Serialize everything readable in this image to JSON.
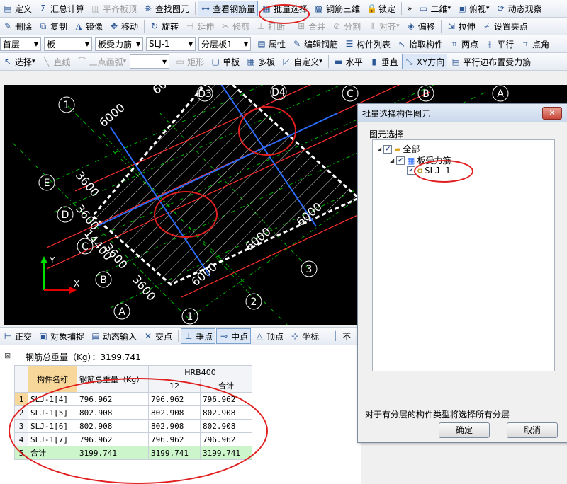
{
  "toolbar1": [
    {
      "label": "定义",
      "icon": "define-icon",
      "glyph": "▤"
    },
    {
      "label": "汇总计算",
      "icon": "sum-icon",
      "glyph": "Σ"
    },
    {
      "label": "平齐板顶",
      "icon": "align-slab-icon",
      "glyph": "▥",
      "disabled": true
    },
    {
      "label": "查找图元",
      "icon": "binoculars-icon",
      "glyph": "⛯"
    },
    {
      "label": "查看钢筋量",
      "icon": "view-rebar-icon",
      "glyph": "⊶",
      "pressed": true
    },
    {
      "label": "批量选择",
      "icon": "batch-select-icon",
      "glyph": "▦"
    },
    {
      "label": "钢筋三维",
      "icon": "rebar-3d-icon",
      "glyph": "▩"
    },
    {
      "label": "锁定",
      "icon": "lock-icon",
      "glyph": "🔒"
    },
    {
      "label": "»",
      "icon": "overflow-icon",
      "glyph": ""
    },
    {
      "label": "二维",
      "icon": "2d-icon",
      "glyph": "▭",
      "combo": true
    },
    {
      "label": "俯视",
      "icon": "top-view-icon",
      "glyph": "▣",
      "combo": true
    },
    {
      "label": "动态观察",
      "icon": "orbit-icon",
      "glyph": "⟳"
    }
  ],
  "toolbar2": [
    {
      "label": "删除",
      "icon": "delete-icon",
      "glyph": "✎"
    },
    {
      "label": "复制",
      "icon": "copy-icon",
      "glyph": "⧉"
    },
    {
      "label": "镜像",
      "icon": "mirror-icon",
      "glyph": "◮"
    },
    {
      "label": "移动",
      "icon": "move-icon",
      "glyph": "✥"
    },
    {
      "label": "旋转",
      "icon": "rotate-icon",
      "glyph": "↻"
    },
    {
      "label": "延伸",
      "icon": "extend-icon",
      "glyph": "⊣",
      "disabled": true
    },
    {
      "label": "修剪",
      "icon": "trim-icon",
      "glyph": "✂",
      "disabled": true
    },
    {
      "label": "打断",
      "icon": "break-icon",
      "glyph": "⊥",
      "disabled": true
    },
    {
      "label": "合并",
      "icon": "merge-icon",
      "glyph": "⊞",
      "disabled": true
    },
    {
      "label": "分割",
      "icon": "split-icon",
      "glyph": "⊘",
      "disabled": true
    },
    {
      "label": "对齐",
      "icon": "align-icon",
      "glyph": "⫴",
      "disabled": true,
      "combo": true
    },
    {
      "label": "偏移",
      "icon": "offset-icon",
      "glyph": "◈"
    },
    {
      "label": "拉伸",
      "icon": "stretch-icon",
      "glyph": "⇲"
    },
    {
      "label": "设置夹点",
      "icon": "grip-icon",
      "glyph": "⌿"
    }
  ],
  "toolbar3": {
    "floor": "首层",
    "category": "板",
    "type": "板受力筋",
    "element": "SLJ-1",
    "layer": "分层板1",
    "buttons": [
      {
        "label": "属性",
        "icon": "properties-icon",
        "glyph": "▤"
      },
      {
        "label": "编辑钢筋",
        "icon": "edit-rebar-icon",
        "glyph": "✎"
      },
      {
        "label": "构件列表",
        "icon": "component-list-icon",
        "glyph": "☰"
      },
      {
        "label": "拾取构件",
        "icon": "pick-icon",
        "glyph": "↖"
      },
      {
        "label": "两点",
        "icon": "two-point-icon",
        "glyph": "⌗"
      },
      {
        "label": "平行",
        "icon": "parallel-icon",
        "glyph": "⫲"
      },
      {
        "label": "点角",
        "icon": "point-angle-icon",
        "glyph": "⌗"
      }
    ]
  },
  "toolbar4": [
    {
      "label": "选择",
      "icon": "select-arrow-icon",
      "glyph": "↖",
      "combo": true
    },
    {
      "label": "直线",
      "icon": "line-icon",
      "glyph": "╲",
      "disabled": true
    },
    {
      "label": "三点画弧",
      "icon": "arc-icon",
      "glyph": "⌒",
      "disabled": true,
      "combo": true
    },
    {
      "label": "",
      "icon": "blank-combo-icon",
      "glyph": "",
      "blankcombo": true
    },
    {
      "label": "矩形",
      "icon": "rect-icon",
      "glyph": "▭",
      "disabled": true
    },
    {
      "label": "单板",
      "icon": "single-slab-icon",
      "glyph": "▢"
    },
    {
      "label": "多板",
      "icon": "multi-slab-icon",
      "glyph": "▦"
    },
    {
      "label": "自定义",
      "icon": "custom-icon",
      "glyph": "◸",
      "combo": true
    },
    {
      "label": "水平",
      "icon": "horizontal-icon",
      "glyph": "▬"
    },
    {
      "label": "垂直",
      "icon": "vertical-icon",
      "glyph": "▮"
    },
    {
      "label": "XY方向",
      "icon": "xy-direction-icon",
      "glyph": "⤡",
      "pressed": true
    },
    {
      "label": "平行边布置受力筋",
      "icon": "parallel-edge-icon",
      "glyph": "▤"
    }
  ],
  "cad": {
    "axis_labels": [
      {
        "t": "1"
      },
      {
        "t": "E"
      },
      {
        "t": "D"
      },
      {
        "t": "C"
      },
      {
        "t": "B"
      },
      {
        "t": "A"
      },
      {
        "t": "1"
      },
      {
        "t": "2"
      },
      {
        "t": "3"
      },
      {
        "t": "D3"
      },
      {
        "t": "D4"
      },
      {
        "t": "C"
      },
      {
        "t": "B"
      },
      {
        "t": "A"
      }
    ],
    "dims": [
      {
        "t": "6000"
      },
      {
        "t": "600"
      },
      {
        "t": "3600"
      },
      {
        "t": "3600"
      },
      {
        "t": "14400"
      },
      {
        "t": "3600"
      },
      {
        "t": "3600"
      },
      {
        "t": "6000"
      },
      {
        "t": "6000"
      },
      {
        "t": "6000"
      }
    ],
    "ucs_x": "X",
    "ucs_y": "Y"
  },
  "statusbar": [
    {
      "label": "正交",
      "icon": "ortho-icon",
      "glyph": "⊢"
    },
    {
      "label": "对象捕捉",
      "icon": "snap-icon",
      "glyph": "▣"
    },
    {
      "label": "动态输入",
      "icon": "dynamic-input-icon",
      "glyph": "▤"
    },
    {
      "label": "交点",
      "icon": "intersection-icon",
      "glyph": "✕"
    },
    {
      "label": "垂点",
      "icon": "perpendicular-icon",
      "glyph": "⊥",
      "pressed": true
    },
    {
      "label": "中点",
      "icon": "midpoint-icon",
      "glyph": "⊸",
      "pressed": true
    },
    {
      "label": "顶点",
      "icon": "vertex-icon",
      "glyph": "△"
    },
    {
      "label": "坐标",
      "icon": "coordinate-icon",
      "glyph": "⊹"
    },
    {
      "label": "不",
      "icon": "more-icon",
      "glyph": "│"
    }
  ],
  "bottom": {
    "total_label": "钢筋总重量（Kg）：3199.741",
    "headers": {
      "name": "构件名称",
      "weight": "钢筋总重量（Kg）",
      "grade": "HRB400",
      "d12": "12",
      "sum": "合计"
    },
    "rows": [
      {
        "n": "1",
        "name": "SLJ-1[4]",
        "w": "796.962",
        "d": "796.962",
        "s": "796.962"
      },
      {
        "n": "2",
        "name": "SLJ-1[5]",
        "w": "802.908",
        "d": "802.908",
        "s": "802.908"
      },
      {
        "n": "3",
        "name": "SLJ-1[6]",
        "w": "802.908",
        "d": "802.908",
        "s": "802.908"
      },
      {
        "n": "4",
        "name": "SLJ-1[7]",
        "w": "796.962",
        "d": "796.962",
        "s": "796.962"
      },
      {
        "n": "5",
        "name": "合计",
        "w": "3199.741",
        "d": "3199.741",
        "s": "3199.741"
      }
    ]
  },
  "dialog": {
    "title": "批量选择构件图元",
    "close": "✕",
    "tree_label": "图元选择",
    "tree": [
      {
        "label": "全部",
        "level": 0
      },
      {
        "label": "板受力筋",
        "level": 1
      },
      {
        "label": "SLJ-1",
        "level": 2
      }
    ],
    "note": "对于有分层的构件类型将选择所有分层",
    "ok": "确定",
    "cancel": "取消"
  },
  "colors": {
    "annotation": "#e02020",
    "slab_border": "#ffffff",
    "axis": "#00c800",
    "red_line": "#ff3030",
    "blue_line": "#2a6cff"
  }
}
